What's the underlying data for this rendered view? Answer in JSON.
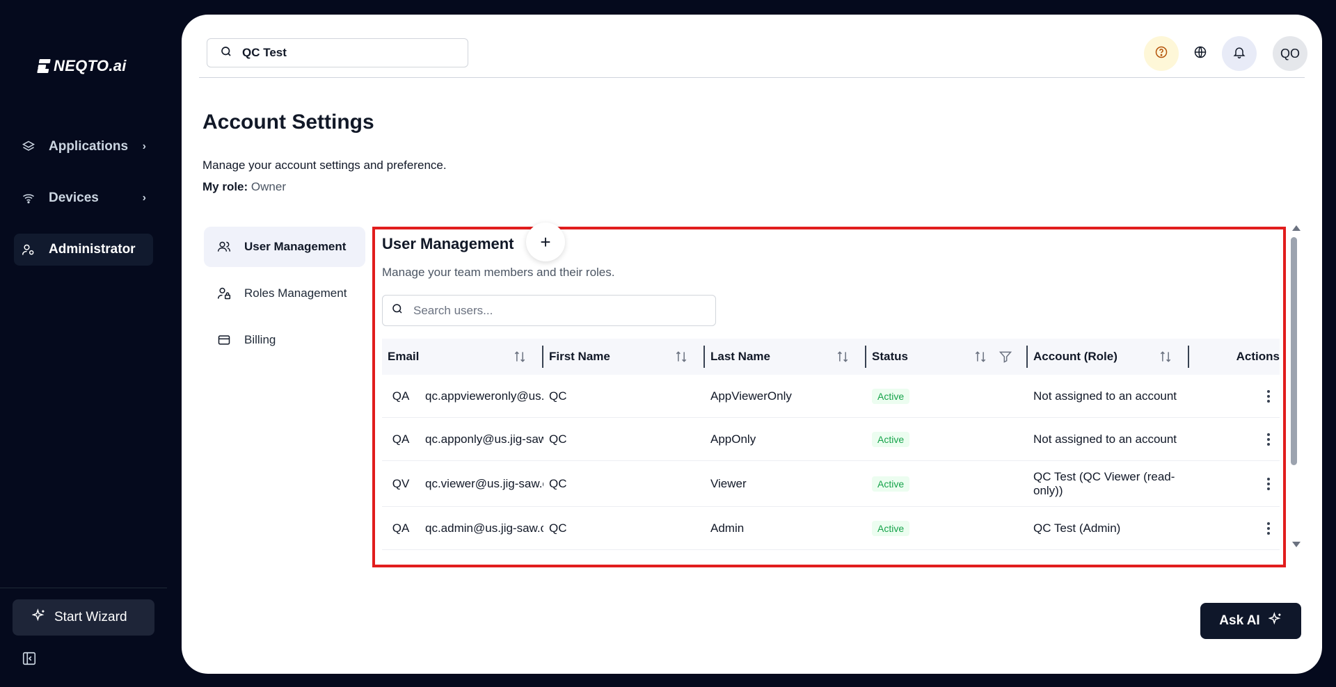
{
  "brand": {
    "name": "NEQTO.ai"
  },
  "sidebar": {
    "items": [
      {
        "label": "Applications",
        "icon": "layers-icon",
        "has_chevron": true
      },
      {
        "label": "Devices",
        "icon": "wifi-icon",
        "has_chevron": true
      },
      {
        "label": "Administrator",
        "icon": "user-gear-icon",
        "active": true
      }
    ],
    "wizard_label": "Start Wizard"
  },
  "topbar": {
    "search_value": "QC Test",
    "avatar_initials": "QO"
  },
  "page": {
    "title": "Account Settings",
    "description": "Manage your account settings and preference.",
    "role_label": "My role:",
    "role_value": "Owner"
  },
  "settings_tabs": [
    {
      "label": "User Management",
      "active": true
    },
    {
      "label": "Roles Management"
    },
    {
      "label": "Billing"
    }
  ],
  "user_management": {
    "title": "User Management",
    "add_label": "+",
    "description": "Manage your team members and their roles.",
    "search_placeholder": "Search users...",
    "columns": [
      "Email",
      "First Name",
      "Last Name",
      "Status",
      "Account (Role)",
      "Actions"
    ],
    "rows": [
      {
        "initials": "QA",
        "email": "qc.appvieweronly@us.jig-saw.com",
        "first": "QC",
        "last": "AppViewerOnly",
        "status": "Active",
        "role": "Not assigned to an account"
      },
      {
        "initials": "QA",
        "email": "qc.apponly@us.jig-saw.com",
        "first": "QC",
        "last": "AppOnly",
        "status": "Active",
        "role": "Not assigned to an account"
      },
      {
        "initials": "QV",
        "email": "qc.viewer@us.jig-saw.com",
        "first": "QC",
        "last": "Viewer",
        "status": "Active",
        "role": "QC Test (QC Viewer (read-only))"
      },
      {
        "initials": "QA",
        "email": "qc.admin@us.jig-saw.com",
        "first": "QC",
        "last": "Admin",
        "status": "Active",
        "role": "QC Test (Admin)"
      }
    ]
  },
  "ask_ai": {
    "label": "Ask AI"
  },
  "colors": {
    "sidebar_bg": "#050a1d",
    "highlight_border": "#e11d1d",
    "status_green": "#16a34a"
  }
}
